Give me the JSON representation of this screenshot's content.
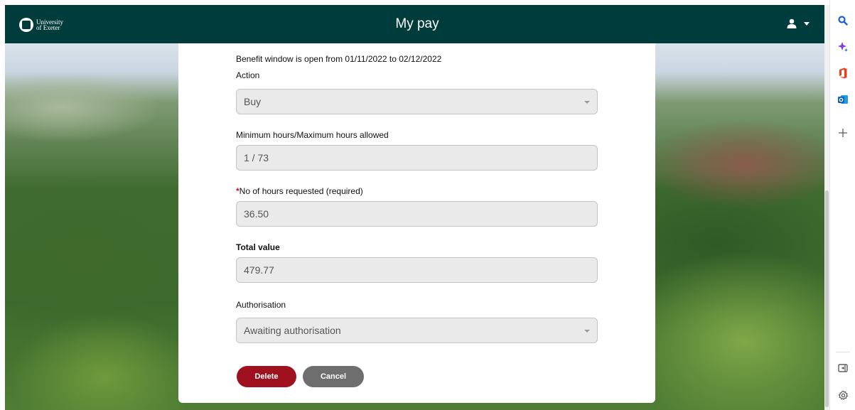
{
  "header": {
    "logo_line1": "University",
    "logo_line2": "of Exeter",
    "title": "My pay"
  },
  "form": {
    "window_note": "Benefit window is open from 01/11/2022 to 02/12/2022",
    "action": {
      "label": "Action",
      "value": "Buy"
    },
    "min_max": {
      "label": "Minimum hours/Maximum hours allowed",
      "value": "1 / 73"
    },
    "hours_requested": {
      "required_marker": "*",
      "label": "No of hours requested (required)",
      "value": "36.50"
    },
    "total_value": {
      "label": "Total value",
      "value": "479.77"
    },
    "authorisation": {
      "label": "Authorisation",
      "value": "Awaiting authorisation"
    },
    "delete_label": "Delete",
    "cancel_label": "Cancel"
  },
  "colors": {
    "header_bg": "#003c3c",
    "delete_button": "#a0111f",
    "cancel_button": "#6e6e6e",
    "required_star": "#c8102e"
  },
  "sidebar_icons": [
    "search-icon",
    "copilot-icon",
    "office-icon",
    "outlook-icon",
    "add-icon",
    "split-screen-icon",
    "settings-icon"
  ]
}
